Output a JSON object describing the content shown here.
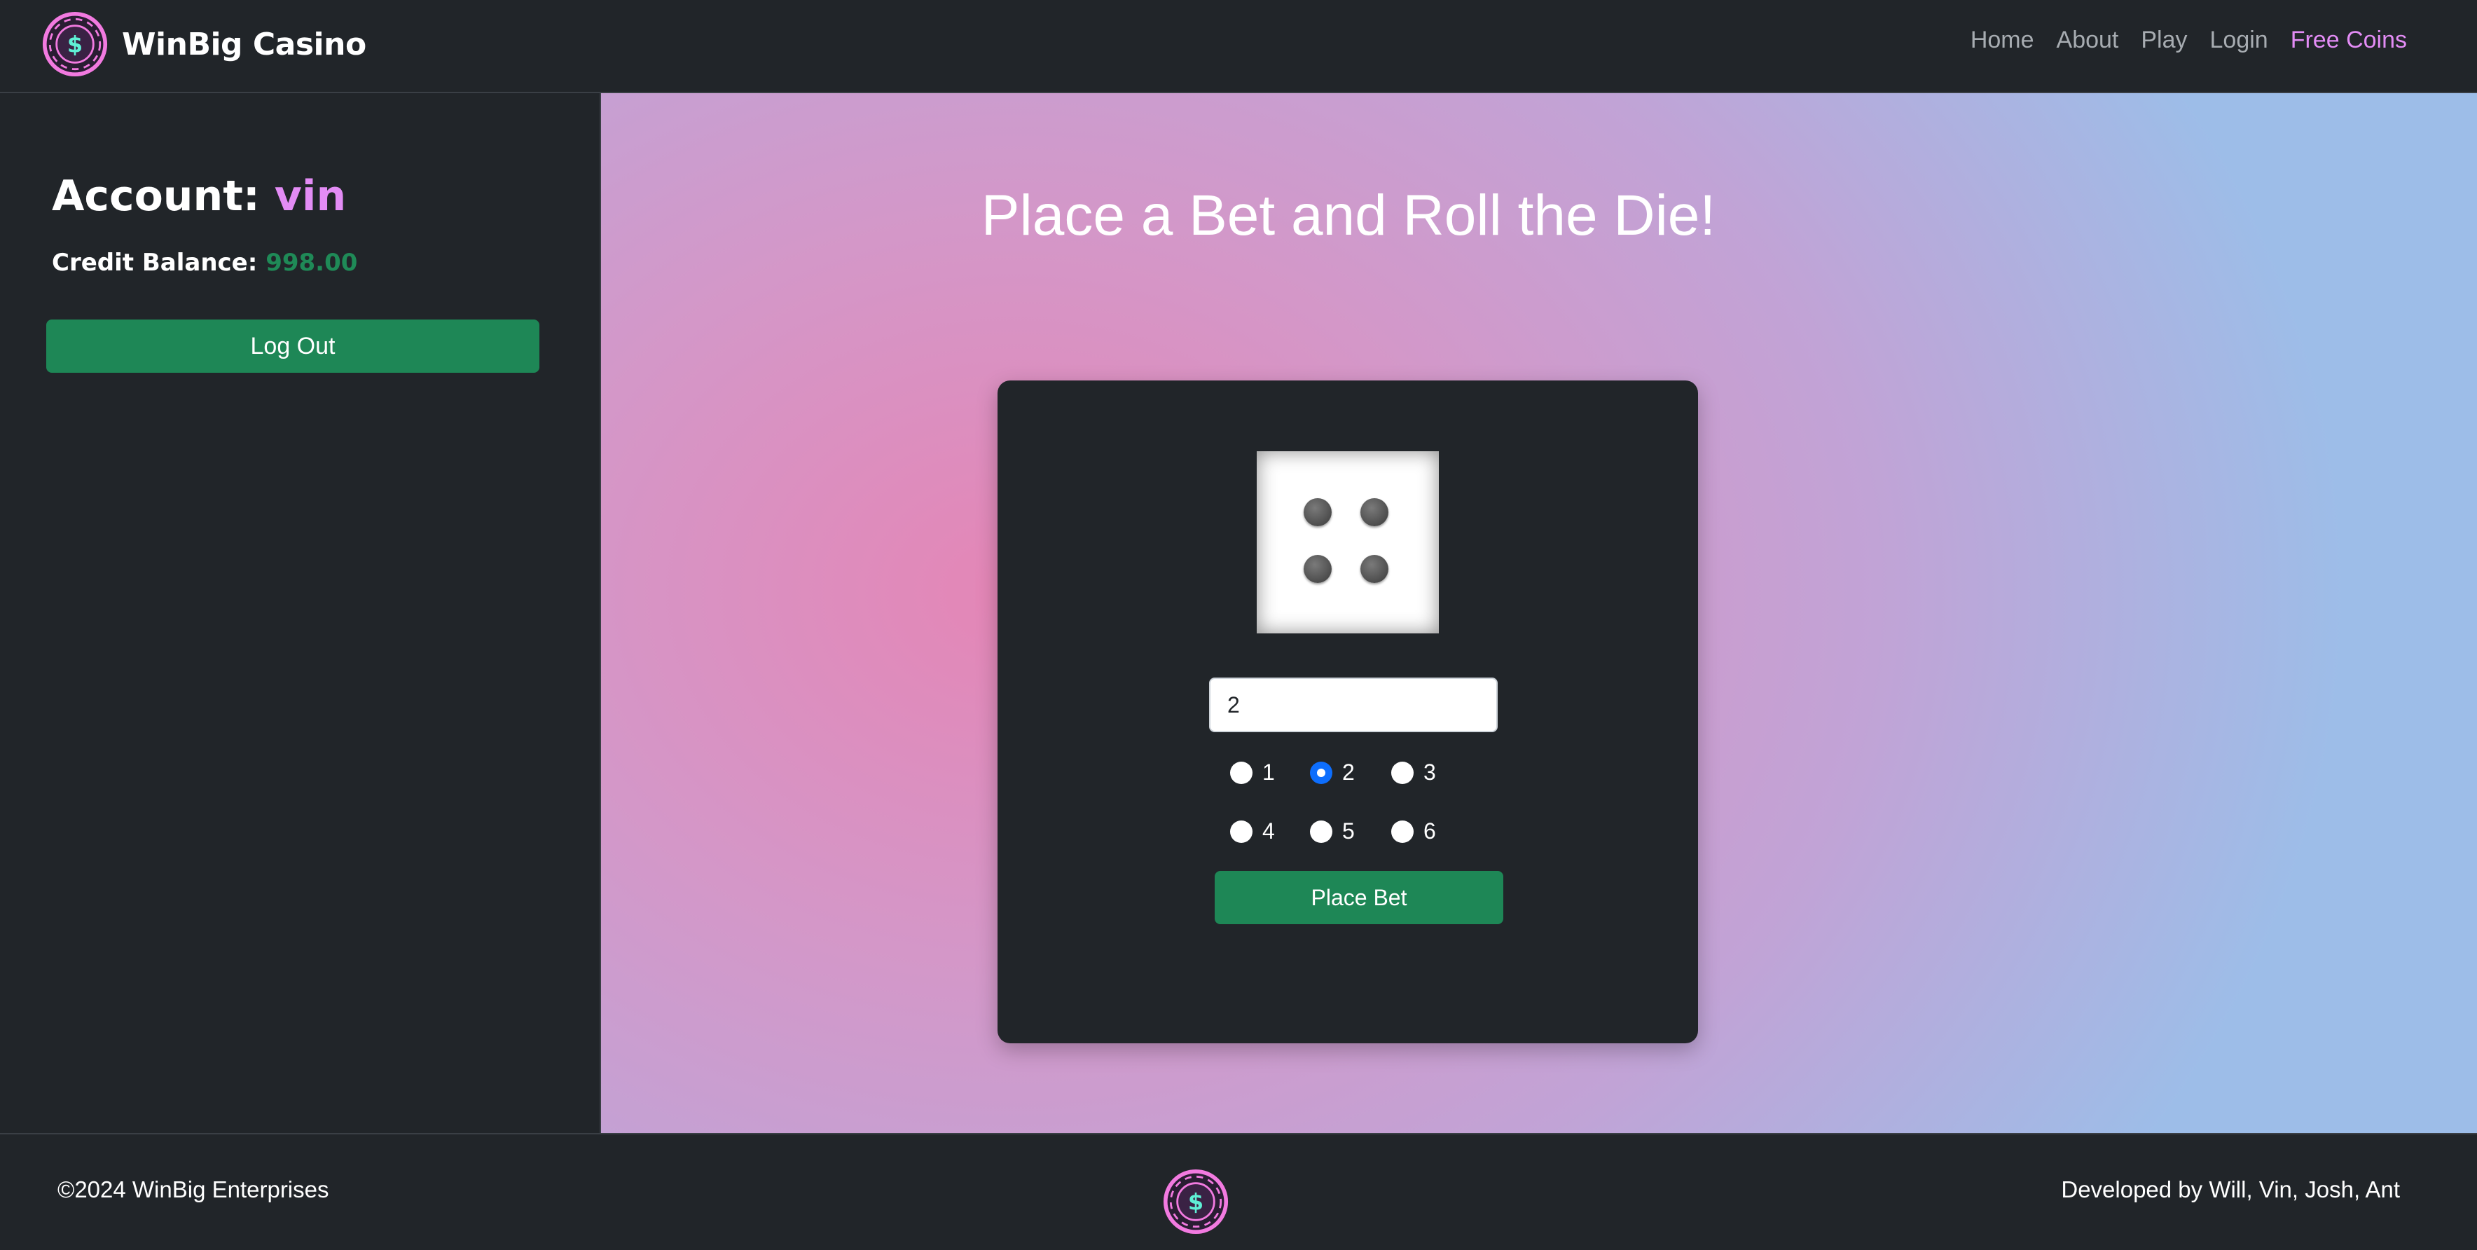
{
  "navbar": {
    "brand": "WinBig Casino",
    "links": [
      "Home",
      "About",
      "Play",
      "Login",
      "Free Coins"
    ]
  },
  "sidebar": {
    "account_label": "Account:",
    "username": "vin",
    "credit_label": "Credit Balance:",
    "credit_amount": "998.00",
    "logout_label": "Log Out"
  },
  "main": {
    "heading": "Place a Bet and Roll the Die!",
    "die_face": 4,
    "bet_value": "2",
    "selected_number": 2,
    "radio_options": [
      "1",
      "2",
      "3",
      "4",
      "5",
      "6"
    ],
    "place_bet_label": "Place Bet"
  },
  "footer": {
    "copyright": "©2024 WinBig Enterprises",
    "credits": "Developed by Will, Vin, Josh, Ant"
  },
  "colors": {
    "accent_purple": "#e38cf5",
    "button_green": "#1e8756",
    "balance_green": "#1f8a57",
    "dark_bg": "#212529"
  },
  "icons": {
    "logo": "casino-chip-dollar-icon"
  }
}
